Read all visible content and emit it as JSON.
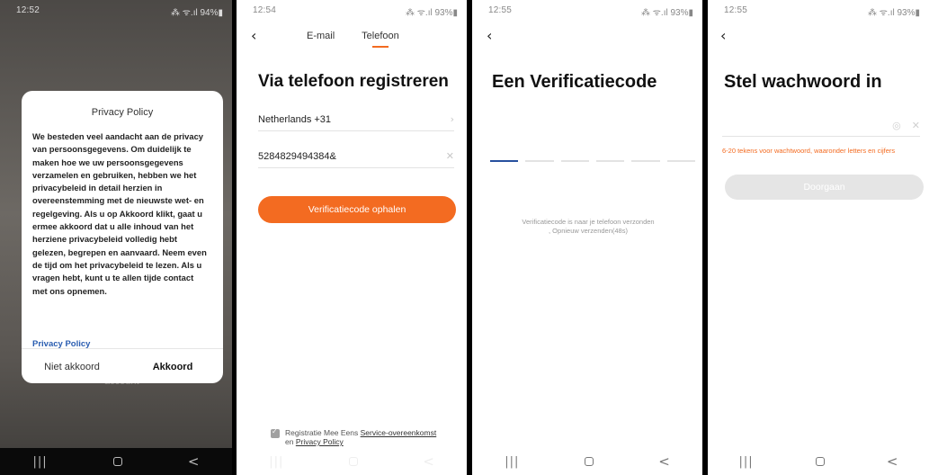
{
  "screens": [
    {
      "status": {
        "time": "12:52",
        "right": "⁂ ᯤ.ıl 94%▮"
      },
      "background_text": "account",
      "modal": {
        "title": "Privacy Policy",
        "body": "We besteden veel aandacht aan de privacy van persoonsgegevens. Om duidelijk te maken hoe we uw persoonsgegevens verzamelen en gebruiken, hebben we het privacybeleid in detail herzien in overeenstemming met de nieuwste wet- en regelgeving. Als u op Akkoord klikt, gaat u ermee akkoord dat u alle inhoud van het herziene privacybeleid volledig hebt gelezen, begrepen en aanvaard. Neem even de tijd om het privacybeleid te lezen. Als u vragen hebt, kunt u te allen tijde contact met ons opnemen.",
        "link": "Privacy Policy",
        "decline": "Niet akkoord",
        "accept": "Akkoord"
      }
    },
    {
      "status": {
        "time": "12:54",
        "right": "⁂ ᯤ.ıl 93%▮"
      },
      "tabs": [
        "E-mail",
        "Telefoon"
      ],
      "title": "Via telefoon registreren",
      "country": "Netherlands +31",
      "phone": "5284829494384&",
      "button": "Verificatiecode ophalen",
      "terms_prefix": "Registratie Mee Eens",
      "terms_link1": "Service-overeenkomst",
      "terms_and": "en",
      "terms_link2": "Privacy Policy"
    },
    {
      "status": {
        "time": "12:55",
        "right": "⁂ ᯤ.ıl 93%▮"
      },
      "title": "Een Verificatiecode",
      "info_line1": "Verificatiecode is naar je telefoon verzonden",
      "info_line2": ", Opnieuw verzenden(48s)"
    },
    {
      "status": {
        "time": "12:55",
        "right": "⁂ ᯤ.ıl 93%▮"
      },
      "title": "Stel wachwoord in",
      "hint": "6-20 tekens voor wachtwoord, waaronder letters en cijfers",
      "button": "Doorgaan"
    }
  ],
  "nav": {
    "recent": "|||",
    "back": "<"
  },
  "icons": {
    "back": "chevron-left-icon",
    "next": "chevron-right-icon",
    "clear": "close-icon",
    "eye": "eye-icon",
    "checkbox": "check-icon"
  },
  "colors": {
    "accent": "#f36b21",
    "active_slot": "#27509e",
    "link": "#2a5db0",
    "disabled_button": "#e5e5e5"
  }
}
